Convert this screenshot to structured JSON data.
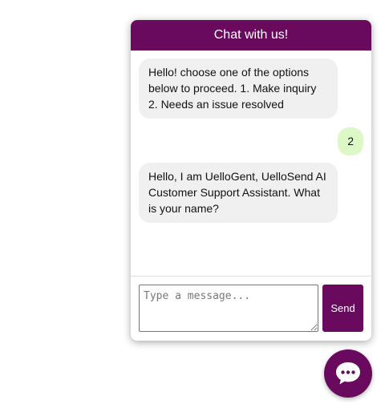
{
  "header": {
    "title": "Chat with us!"
  },
  "messages": [
    {
      "sender": "bot",
      "text": "Hello! choose one of the options below to proceed. 1. Make inquiry 2. Needs an issue resolved"
    },
    {
      "sender": "user",
      "text": "2"
    },
    {
      "sender": "bot",
      "text": "Hello, I am UelloGent, UelloSend AI Customer Support Assistant. What is your name?"
    }
  ],
  "composer": {
    "placeholder": "Type a message...",
    "value": "",
    "send_label": "Send"
  },
  "launcher": {
    "icon": "chat-bubble-icon"
  },
  "colors": {
    "brand": "#6a0a5e",
    "bot_bubble": "#f0f0f0",
    "user_bubble": "#dcf8c6"
  }
}
